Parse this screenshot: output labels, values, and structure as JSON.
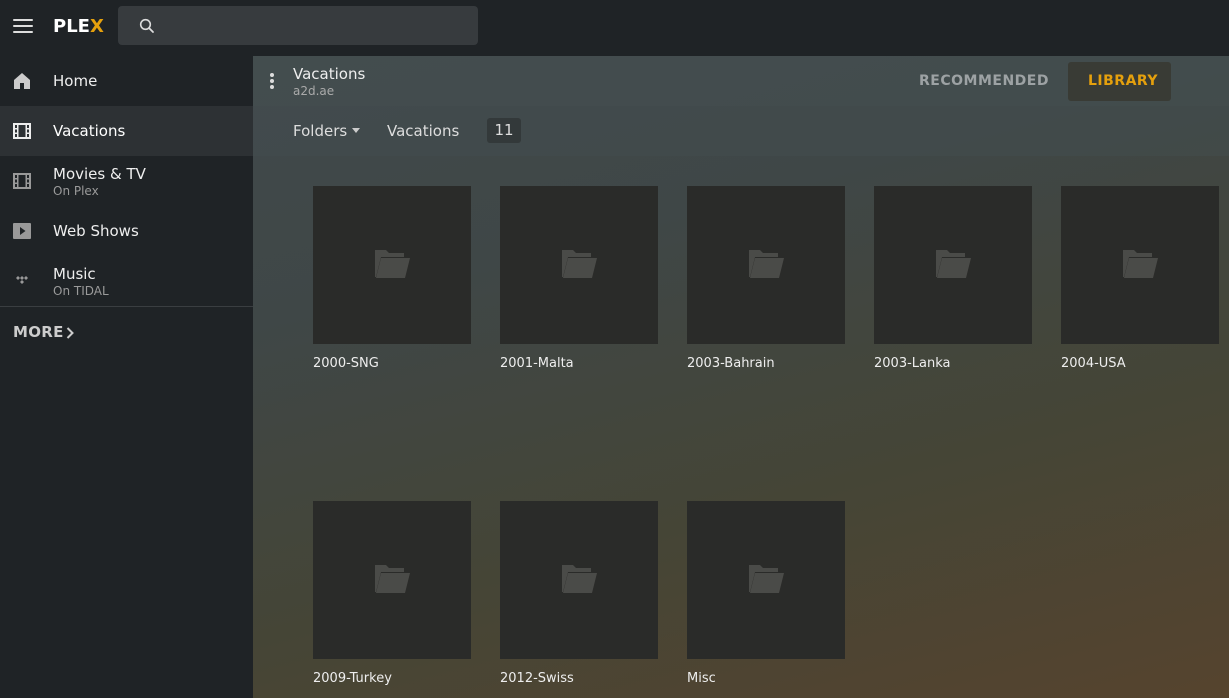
{
  "app": {
    "logo_text": "PLE",
    "logo_accent": "X",
    "accent_color": "#e5a00d"
  },
  "search": {
    "placeholder": ""
  },
  "sidebar": {
    "items": [
      {
        "label": "Home",
        "sub": "",
        "icon": "home-icon"
      },
      {
        "label": "Vacations",
        "sub": "",
        "icon": "film-icon",
        "active": true
      },
      {
        "label": "Movies & TV",
        "sub": "On Plex",
        "icon": "film-icon"
      },
      {
        "label": "Web Shows",
        "sub": "",
        "icon": "play-icon"
      },
      {
        "label": "Music",
        "sub": "On TIDAL",
        "icon": "tidal-icon"
      }
    ],
    "more_label": "MORE"
  },
  "library": {
    "title": "Vacations",
    "server": "a2d.ae",
    "tabs": {
      "recommended": "RECOMMENDED",
      "library": "LIBRARY"
    }
  },
  "filter": {
    "view": "Folders",
    "breadcrumb": "Vacations",
    "count": "11"
  },
  "folders": [
    {
      "name": "2000-SNG"
    },
    {
      "name": "2001-Malta"
    },
    {
      "name": "2003-Bahrain"
    },
    {
      "name": "2003-Lanka"
    },
    {
      "name": "2004-USA"
    },
    {
      "name": "2009-Turkey"
    },
    {
      "name": "2012-Swiss"
    },
    {
      "name": "Misc"
    }
  ]
}
